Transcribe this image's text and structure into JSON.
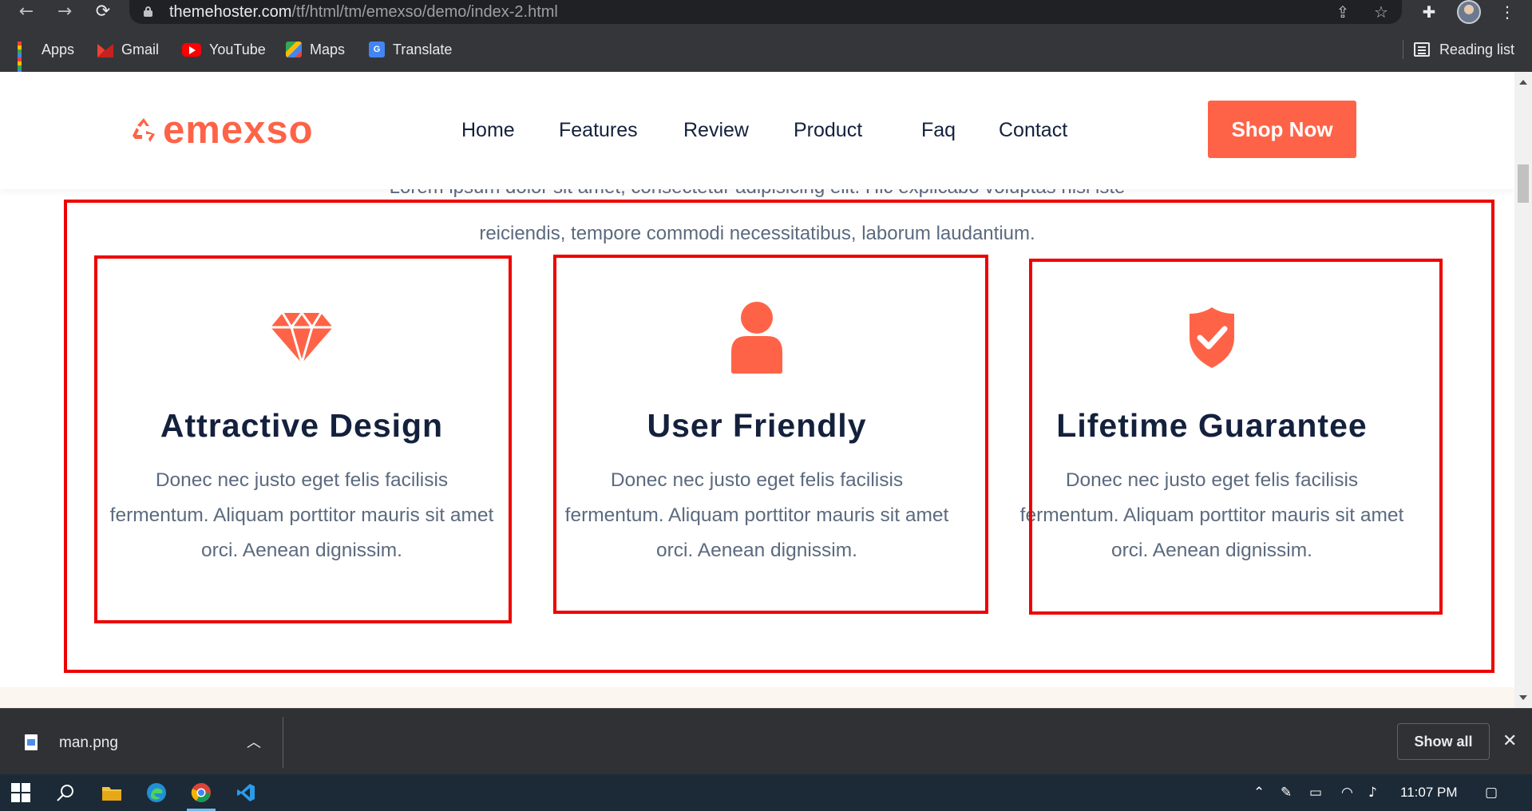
{
  "browser": {
    "url_host": "themehoster.com",
    "url_path": "/tf/html/tm/emexso/demo/index-2.html",
    "nav": {
      "back_icon": "←",
      "forward_icon": "→",
      "reload_icon": "⟳"
    },
    "bookmarks": [
      {
        "label": "Apps",
        "icon": "apps-grid-icon"
      },
      {
        "label": "Gmail",
        "icon": "gmail-icon"
      },
      {
        "label": "YouTube",
        "icon": "youtube-icon"
      },
      {
        "label": "Maps",
        "icon": "maps-icon"
      },
      {
        "label": "Translate",
        "icon": "translate-icon"
      }
    ],
    "reading_list": "Reading list"
  },
  "site": {
    "logo": "emexso",
    "menu": [
      "Home",
      "Features",
      "Review",
      "Product",
      "Faq",
      "Contact"
    ],
    "cta": "Shop Now",
    "accent_color": "#ff6347",
    "heading_color": "#14213d",
    "intro_line1": "Lorem ipsum dolor sit amet, consectetur adipisicing elit. Hic explicabo voluptas nisi iste",
    "intro_line2": "reiciendis, tempore commodi necessitatibus, laborum laudantium.",
    "features": [
      {
        "icon": "diamond-icon",
        "title": "Attractive Design",
        "text": "Donec nec justo eget felis facilisis fermentum. Aliquam porttitor mauris sit amet orci. Aenean dignissim."
      },
      {
        "icon": "user-icon",
        "title": "User Friendly",
        "text": "Donec nec justo eget felis facilisis fermentum. Aliquam porttitor mauris sit amet orci. Aenean dignissim."
      },
      {
        "icon": "shield-check-icon",
        "title": "Lifetime Guarantee",
        "text": "Donec nec justo eget felis facilisis fermentum. Aliquam porttitor mauris sit amet orci. Aenean dignissim."
      }
    ],
    "annotation_color": "#ee0000"
  },
  "downloads": {
    "file_name": "man.png",
    "show_all": "Show all",
    "close_icon": "✕"
  },
  "taskbar": {
    "time": "11:07 PM"
  }
}
